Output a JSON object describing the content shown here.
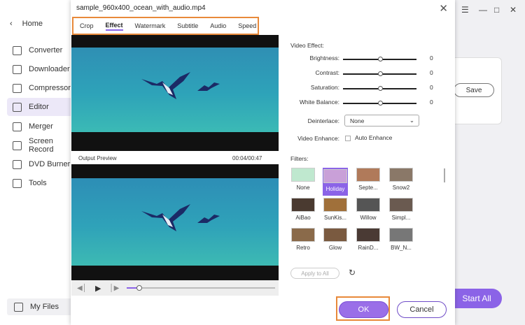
{
  "sidebar": {
    "home": "Home",
    "items": [
      {
        "label": "Converter",
        "icon": "converter-icon"
      },
      {
        "label": "Downloader",
        "icon": "downloader-icon"
      },
      {
        "label": "Compressor",
        "icon": "compressor-icon"
      },
      {
        "label": "Editor",
        "icon": "scissors-icon"
      },
      {
        "label": "Merger",
        "icon": "merger-icon"
      },
      {
        "label": "Screen Record",
        "icon": "screen-record-icon"
      },
      {
        "label": "DVD Burner",
        "icon": "dvd-icon"
      },
      {
        "label": "Tools",
        "icon": "tools-icon"
      }
    ],
    "my_files": "My Files"
  },
  "background": {
    "save_label": "Save",
    "start_all_label": "Start All"
  },
  "dialog": {
    "title": "sample_960x400_ocean_with_audio.mp4",
    "tabs": [
      "Crop",
      "Effect",
      "Watermark",
      "Subtitle",
      "Audio",
      "Speed"
    ],
    "active_tab": "Effect",
    "output_preview_label": "Output Preview",
    "timecode": "00:04/00:47",
    "video_effect_heading": "Video Effect:",
    "adjustments": [
      {
        "label": "Brightness:",
        "value": "0",
        "level": 0.5
      },
      {
        "label": "Contrast:",
        "value": "0",
        "level": 0.5
      },
      {
        "label": "Saturation:",
        "value": "0",
        "level": 0.5
      },
      {
        "label": "White Balance:",
        "value": "0",
        "level": 0.5
      }
    ],
    "deinterlace_label": "Deinterlace:",
    "deinterlace_value": "None",
    "video_enhance_label": "Video Enhance:",
    "auto_enhance_label": "Auto Enhance",
    "filters_label": "Filters:",
    "filters": [
      "None",
      "Holiday",
      "Septe...",
      "Snow2",
      "AiBao",
      "SunKis...",
      "Willow",
      "Simpl...",
      "Retro",
      "Glow",
      "RainD...",
      "BW_N..."
    ],
    "selected_filter": "Holiday",
    "apply_to_all": "Apply to All",
    "seek_progress": 0.08,
    "ok_label": "OK",
    "cancel_label": "Cancel"
  }
}
